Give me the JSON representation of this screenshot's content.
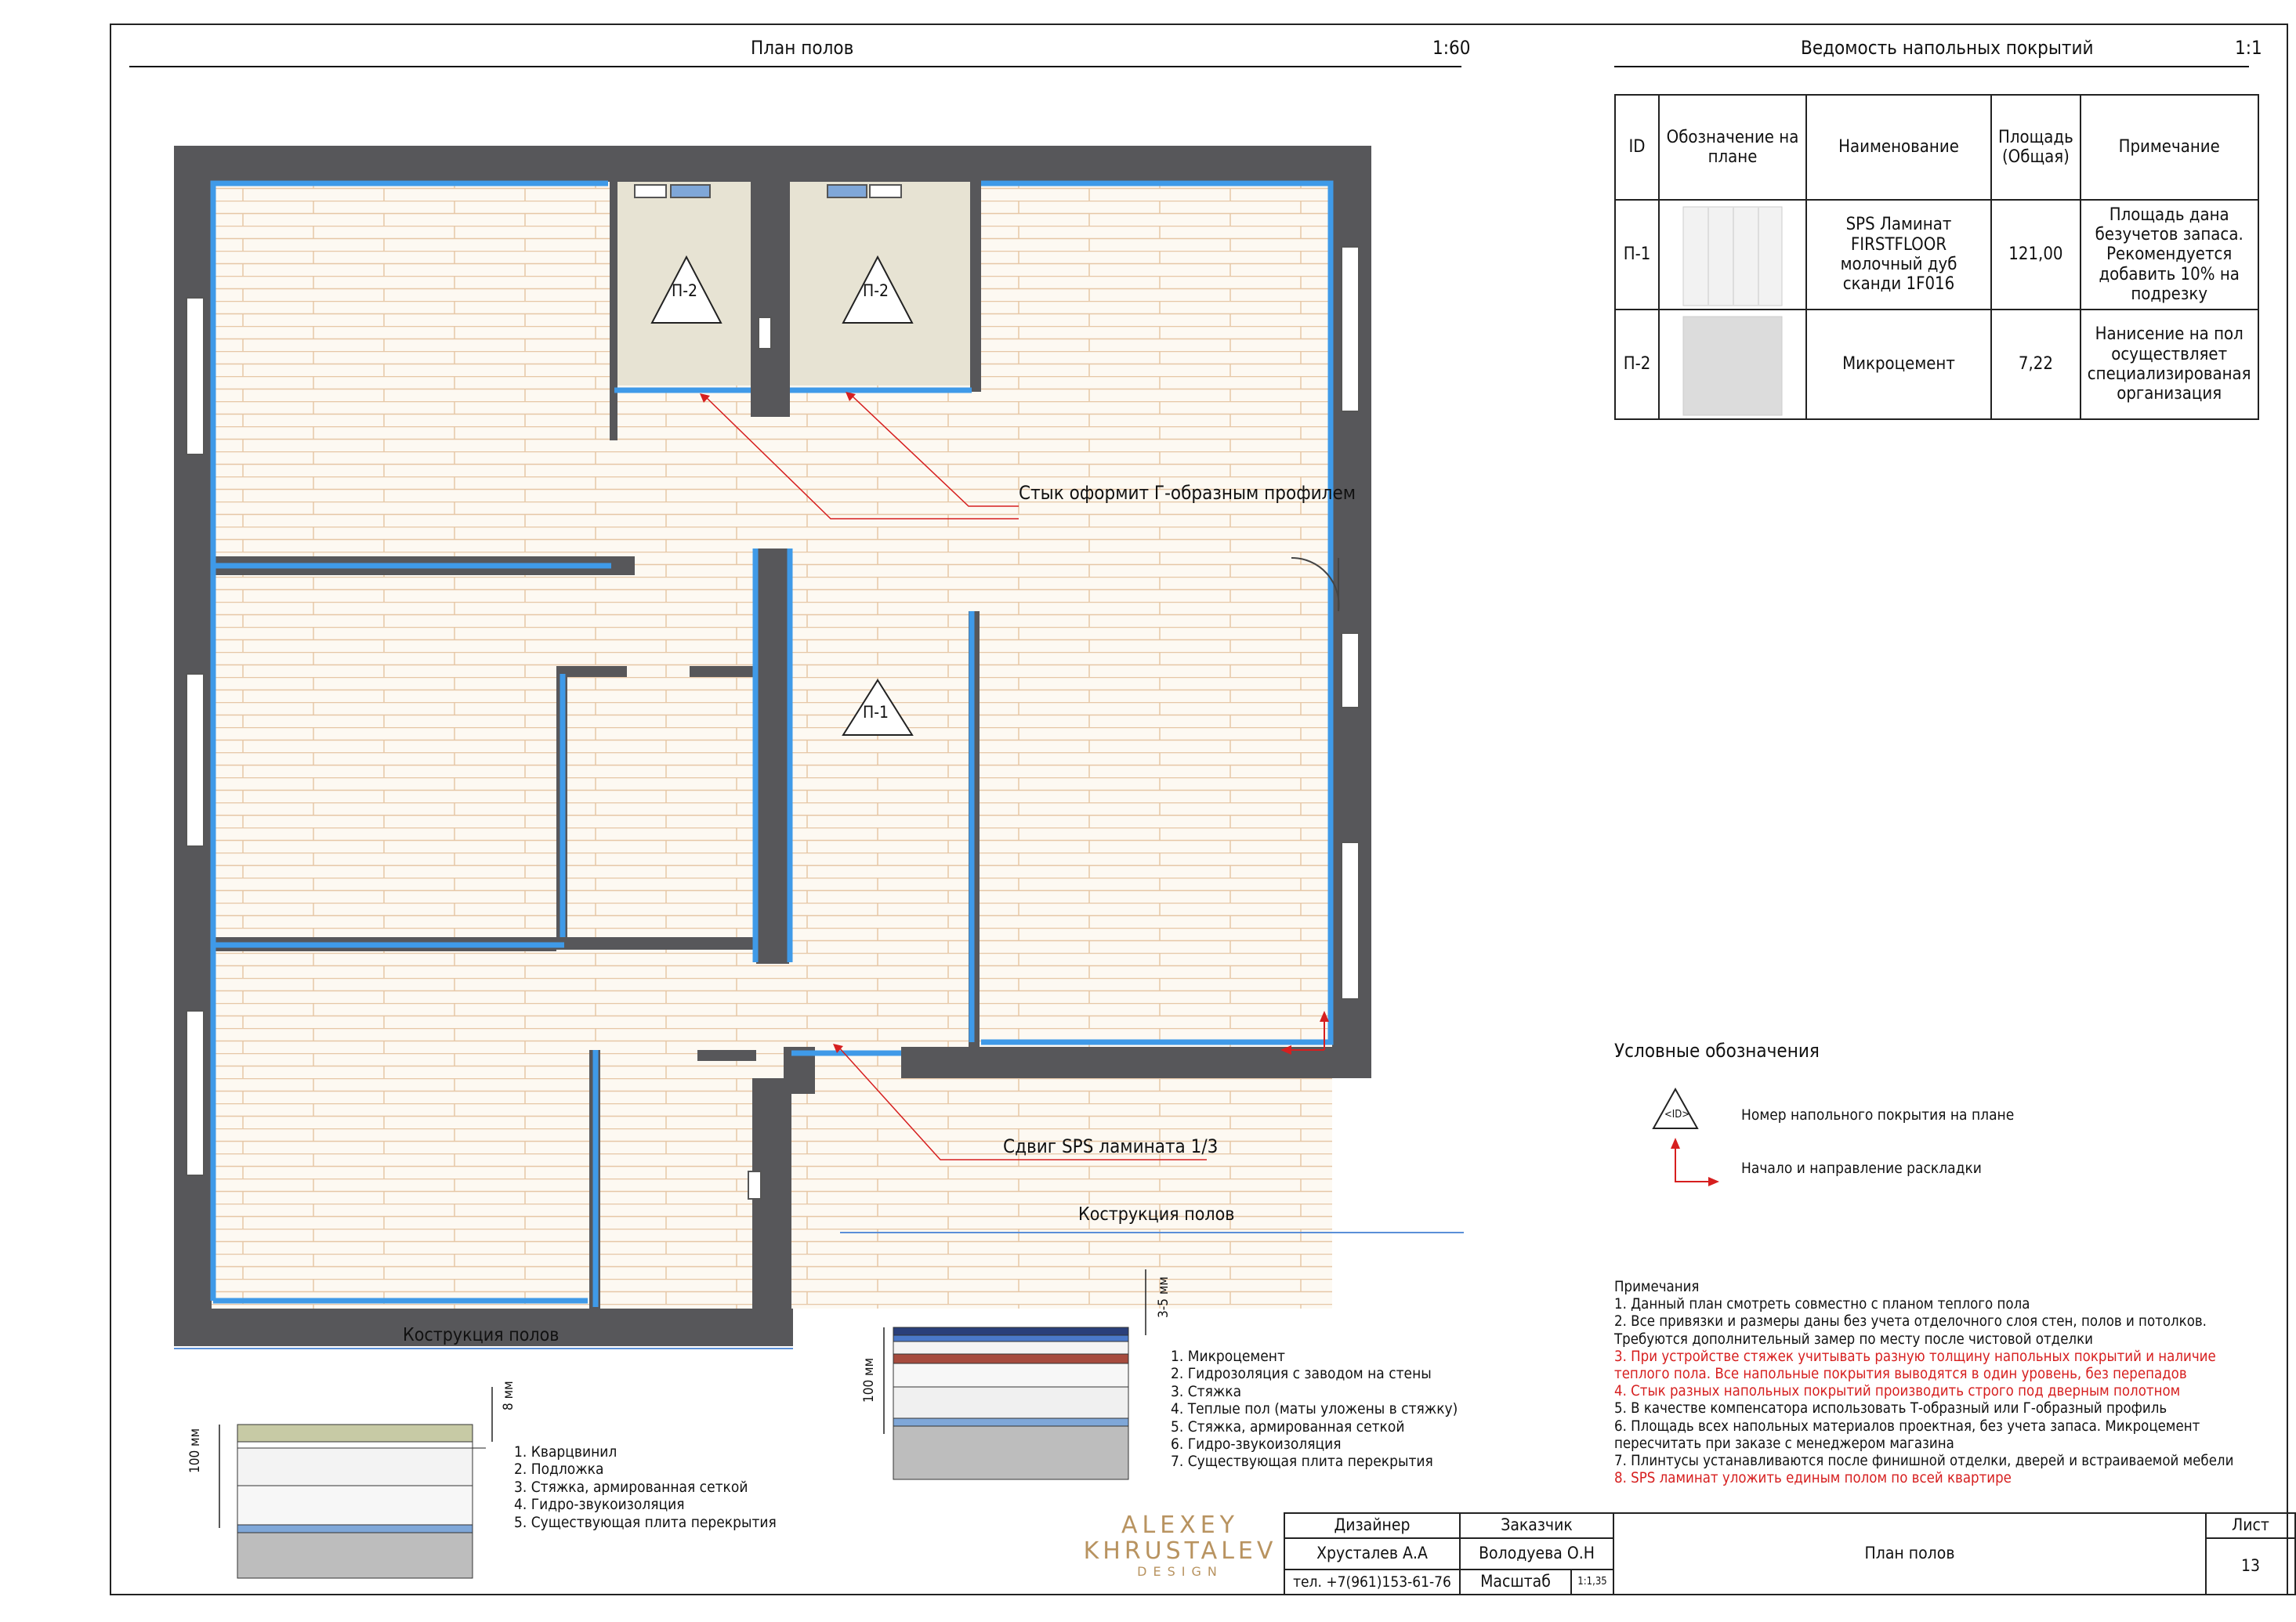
{
  "plan": {
    "title": "План полов",
    "scale": "1:60",
    "floor_labels": {
      "p1": "П-1",
      "p2a": "П-2",
      "p2b": "П-2"
    },
    "callouts": {
      "profile": "Стык оформит Г-образным профилем",
      "shift": "Сдвиг SPS ламината 1/3"
    }
  },
  "schedule": {
    "title": "Ведомость напольных покрытий",
    "scale": "1:1",
    "headers": {
      "id": "ID",
      "designation": "Обозначение на плане",
      "name": "Наименование",
      "area": "Площадь (Общая)",
      "note": "Примечание"
    },
    "rows": [
      {
        "id": "П-1",
        "name": "SPS Ламинат FIRSTFLOOR молочный дуб сканди 1F016",
        "area": "121,00",
        "note": "Площадь дана безучетов запаса. Рекомендуется добавить 10% на подрезку"
      },
      {
        "id": "П-2",
        "name": "Микроцемент",
        "area": "7,22",
        "note": "Нанисение на пол осуществляет специализированая организация"
      }
    ]
  },
  "legend": {
    "title": "Условные обозначения",
    "symbol": "<ID>",
    "items": [
      "Номер напольного покрытия на плане",
      "Начало и направление раскладки"
    ]
  },
  "construction1": {
    "title": "Кострукция полов",
    "dim_total": "100 мм",
    "dim_top": "8 мм",
    "layers": [
      "1. Кварцвинил",
      "2. Подложка",
      "3. Стяжка, армированная сеткой",
      "4. Гидро-звукоизоляция",
      "5. Существующая плита перекрытия"
    ]
  },
  "construction2": {
    "title": "Кострукция полов",
    "dim_total": "100 мм",
    "dim_top": "3-5 мм",
    "layers": [
      "1. Микроцемент",
      "2. Гидрозоляция с заводом на стены",
      "3. Стяжка",
      "4. Теплые пол (маты уложены в стяжку)",
      "5. Стяжка, армированная сеткой",
      "6. Гидро-звукоизоляция",
      "7. Существующая плита перекрытия"
    ]
  },
  "notes": {
    "title": "Примечания",
    "lines": [
      {
        "text": "1. Данный план смотреть совместно с планом теплого пола",
        "red": false
      },
      {
        "text": "2. Все привязки и размеры даны без учета отделочного слоя стен, полов и потолков.",
        "red": false
      },
      {
        "text": "Требуются дополнительный замер по месту после чистовой отделки",
        "red": false
      },
      {
        "text": "3. При устройстве стяжек учитывать разную толщину напольных покрытий и наличие",
        "red": true
      },
      {
        "text": "теплого пола. Все напольные покрытия выводятся в один уровень, без перепадов",
        "red": true
      },
      {
        "text": "4. Стык разных напольных покрытий производить строго под дверным полотном",
        "red": true
      },
      {
        "text": "5. В качестве компенсатора использовать Т-образный или  Г-образный профиль",
        "red": false
      },
      {
        "text": "6. Площадь всех напольных материалов проектная, без учета запаса. Микроцемент",
        "red": false
      },
      {
        "text": "пересчитать при заказе с менеджером магазина",
        "red": false
      },
      {
        "text": "7. Плинтусы устанавливаются после финишной отделки, дверей и встраиваемой мебели",
        "red": false
      },
      {
        "text": "8. SPS ламинат уложить единым полом по всей квартире",
        "red": true
      }
    ]
  },
  "logo": {
    "line1": "ALEXEY",
    "line2": "KHRUSTALEV",
    "line3": "DESIGN"
  },
  "titleblock": {
    "designer_label": "Дизайнер",
    "designer": "Хрусталев А.А",
    "phone": "тел. +7(961)153-61-76",
    "client_label": "Заказчик",
    "client": "Володуева О.Н",
    "scale_label": "Масштаб",
    "scale_value": "1:1,35",
    "sheet_title": "План полов",
    "sheet_label": "Лист",
    "sheet_number": "13"
  }
}
